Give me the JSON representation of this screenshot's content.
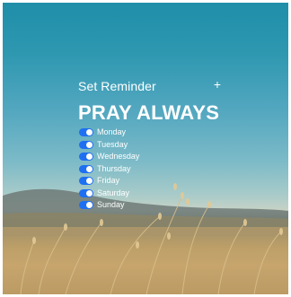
{
  "reminder": {
    "header_label": "Set Reminder",
    "add_label": "+",
    "title": "PRAY ALWAYS"
  },
  "days": [
    {
      "label": "Monday",
      "enabled": true
    },
    {
      "label": "Tuesday",
      "enabled": true
    },
    {
      "label": "Wednesday",
      "enabled": true
    },
    {
      "label": "Thursday",
      "enabled": true
    },
    {
      "label": "Friday",
      "enabled": true
    },
    {
      "label": "Saturday",
      "enabled": true
    },
    {
      "label": "Sunday",
      "enabled": true
    }
  ],
  "colors": {
    "toggle_on": "#1e6ff2",
    "text": "#ffffff",
    "sky_top": "#1f8ea9",
    "field": "#c9a770"
  }
}
